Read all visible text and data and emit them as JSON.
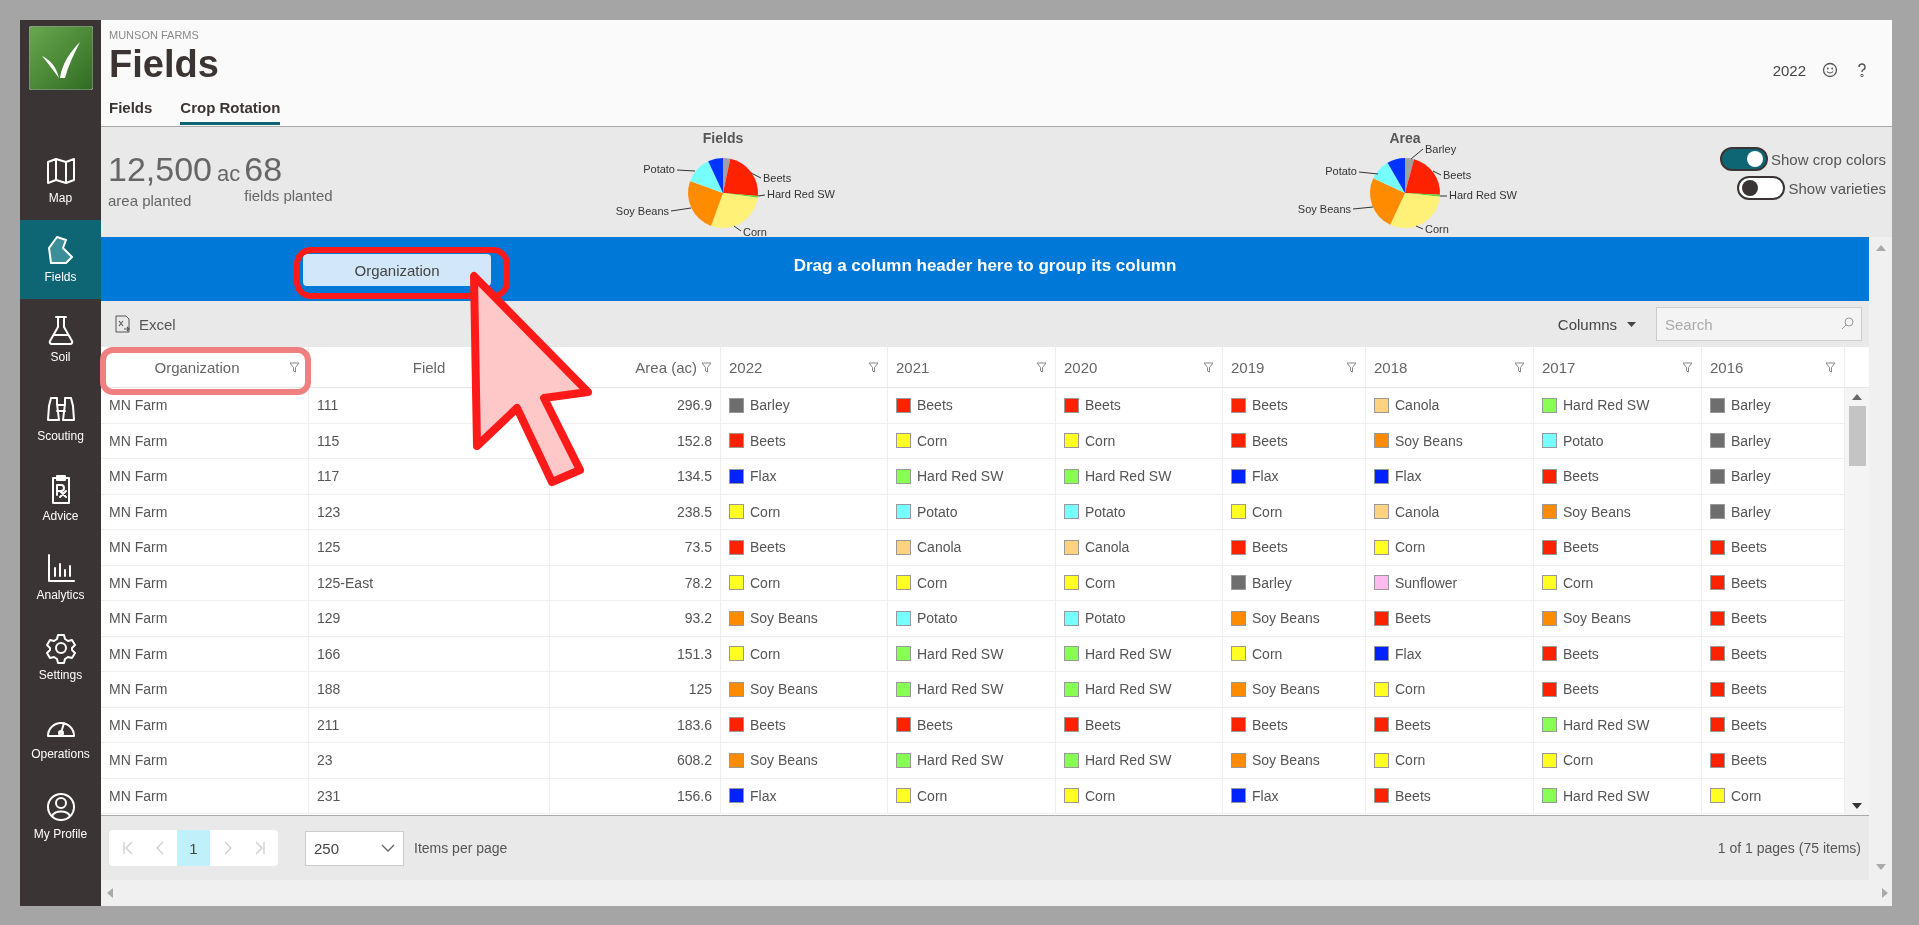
{
  "sidebar": {
    "items": [
      {
        "label": "Map",
        "selected": false
      },
      {
        "label": "Fields",
        "selected": true
      },
      {
        "label": "Soil",
        "selected": false
      },
      {
        "label": "Scouting",
        "selected": false
      },
      {
        "label": "Advice",
        "selected": false
      },
      {
        "label": "Analytics",
        "selected": false
      },
      {
        "label": "Settings",
        "selected": false
      },
      {
        "label": "Operations",
        "selected": false
      },
      {
        "label": "My Profile",
        "selected": false
      }
    ]
  },
  "header": {
    "organization": "MUNSON FARMS",
    "title": "Fields",
    "year": "2022"
  },
  "tabs": [
    {
      "label": "Fields",
      "selected": false
    },
    {
      "label": "Crop Rotation",
      "selected": true
    }
  ],
  "summary": {
    "area": "12,500",
    "area_unit": "ac",
    "area_label": "area planted",
    "fields": "68",
    "fields_label": "fields planted"
  },
  "pies": [
    {
      "title": "Fields",
      "labels": [
        "Potato",
        "Beets",
        "Hard Red SW",
        "Soy Beans",
        "Corn"
      ]
    },
    {
      "title": "Area",
      "labels": [
        "Barley",
        "Potato",
        "Beets",
        "Hard Red SW",
        "Soy Beans",
        "Corn"
      ]
    }
  ],
  "toggles": [
    {
      "label": "Show crop colors",
      "on": true
    },
    {
      "label": "Show varieties",
      "on": false
    }
  ],
  "group_panel": {
    "chips": [
      "Organization"
    ],
    "hint": "Drag a column header here to group its column"
  },
  "toolbar": {
    "export": "Excel",
    "columns": "Columns",
    "search": {
      "placeholder": "Search"
    }
  },
  "table": {
    "columns": [
      {
        "label": "Organization",
        "kind": "text",
        "filter": true
      },
      {
        "label": "Field",
        "kind": "text",
        "filter": false
      },
      {
        "label": "Area (ac)",
        "kind": "number",
        "filter": true
      },
      {
        "label": "2022",
        "kind": "crop",
        "filter": true
      },
      {
        "label": "2021",
        "kind": "crop",
        "filter": true
      },
      {
        "label": "2020",
        "kind": "crop",
        "filter": true
      },
      {
        "label": "2019",
        "kind": "crop",
        "filter": true
      },
      {
        "label": "2018",
        "kind": "crop",
        "filter": true
      },
      {
        "label": "2017",
        "kind": "crop",
        "filter": true
      },
      {
        "label": "2016",
        "kind": "crop",
        "filter": true
      }
    ],
    "rows": [
      {
        "organization": "MN Farm",
        "field": "111",
        "area": "296.9",
        "crops": [
          {
            "name": "Barley",
            "color": "#6e6e6e"
          },
          {
            "name": "Beets",
            "color": "#ff2200"
          },
          {
            "name": "Beets",
            "color": "#ff2200"
          },
          {
            "name": "Beets",
            "color": "#ff2200"
          },
          {
            "name": "Canola",
            "color": "#ffd27f"
          },
          {
            "name": "Hard Red SW",
            "color": "#88ff55"
          },
          {
            "name": "Barley",
            "color": "#6e6e6e"
          }
        ]
      },
      {
        "organization": "MN Farm",
        "field": "115",
        "area": "152.8",
        "crops": [
          {
            "name": "Beets",
            "color": "#ff2200"
          },
          {
            "name": "Corn",
            "color": "#ffff22"
          },
          {
            "name": "Corn",
            "color": "#ffff22"
          },
          {
            "name": "Beets",
            "color": "#ff2200"
          },
          {
            "name": "Soy Beans",
            "color": "#ff8c00"
          },
          {
            "name": "Potato",
            "color": "#77ffff"
          },
          {
            "name": "Barley",
            "color": "#6e6e6e"
          }
        ]
      },
      {
        "organization": "MN Farm",
        "field": "117",
        "area": "134.5",
        "crops": [
          {
            "name": "Flax",
            "color": "#0022ff"
          },
          {
            "name": "Hard Red SW",
            "color": "#88ff55"
          },
          {
            "name": "Hard Red SW",
            "color": "#88ff55"
          },
          {
            "name": "Flax",
            "color": "#0022ff"
          },
          {
            "name": "Flax",
            "color": "#0022ff"
          },
          {
            "name": "Beets",
            "color": "#ff2200"
          },
          {
            "name": "Barley",
            "color": "#6e6e6e"
          }
        ]
      },
      {
        "organization": "MN Farm",
        "field": "123",
        "area": "238.5",
        "crops": [
          {
            "name": "Corn",
            "color": "#ffff22"
          },
          {
            "name": "Potato",
            "color": "#77ffff"
          },
          {
            "name": "Potato",
            "color": "#77ffff"
          },
          {
            "name": "Corn",
            "color": "#ffff22"
          },
          {
            "name": "Canola",
            "color": "#ffd27f"
          },
          {
            "name": "Soy Beans",
            "color": "#ff8c00"
          },
          {
            "name": "Barley",
            "color": "#6e6e6e"
          }
        ]
      },
      {
        "organization": "MN Farm",
        "field": "125",
        "area": "73.5",
        "crops": [
          {
            "name": "Beets",
            "color": "#ff2200"
          },
          {
            "name": "Canola",
            "color": "#ffd27f"
          },
          {
            "name": "Canola",
            "color": "#ffd27f"
          },
          {
            "name": "Beets",
            "color": "#ff2200"
          },
          {
            "name": "Corn",
            "color": "#ffff22"
          },
          {
            "name": "Beets",
            "color": "#ff2200"
          },
          {
            "name": "Beets",
            "color": "#ff2200"
          }
        ]
      },
      {
        "organization": "MN Farm",
        "field": "125-East",
        "area": "78.2",
        "crops": [
          {
            "name": "Corn",
            "color": "#ffff22"
          },
          {
            "name": "Corn",
            "color": "#ffff22"
          },
          {
            "name": "Corn",
            "color": "#ffff22"
          },
          {
            "name": "Barley",
            "color": "#6e6e6e"
          },
          {
            "name": "Sunflower",
            "color": "#ffbbee"
          },
          {
            "name": "Corn",
            "color": "#ffff22"
          },
          {
            "name": "Beets",
            "color": "#ff2200"
          }
        ]
      },
      {
        "organization": "MN Farm",
        "field": "129",
        "area": "93.2",
        "crops": [
          {
            "name": "Soy Beans",
            "color": "#ff8c00"
          },
          {
            "name": "Potato",
            "color": "#77ffff"
          },
          {
            "name": "Potato",
            "color": "#77ffff"
          },
          {
            "name": "Soy Beans",
            "color": "#ff8c00"
          },
          {
            "name": "Beets",
            "color": "#ff2200"
          },
          {
            "name": "Soy Beans",
            "color": "#ff8c00"
          },
          {
            "name": "Beets",
            "color": "#ff2200"
          }
        ]
      },
      {
        "organization": "MN Farm",
        "field": "166",
        "area": "151.3",
        "crops": [
          {
            "name": "Corn",
            "color": "#ffff22"
          },
          {
            "name": "Hard Red SW",
            "color": "#88ff55"
          },
          {
            "name": "Hard Red SW",
            "color": "#88ff55"
          },
          {
            "name": "Corn",
            "color": "#ffff22"
          },
          {
            "name": "Flax",
            "color": "#0022ff"
          },
          {
            "name": "Beets",
            "color": "#ff2200"
          },
          {
            "name": "Beets",
            "color": "#ff2200"
          }
        ]
      },
      {
        "organization": "MN Farm",
        "field": "188",
        "area": "125",
        "crops": [
          {
            "name": "Soy Beans",
            "color": "#ff8c00"
          },
          {
            "name": "Hard Red SW",
            "color": "#88ff55"
          },
          {
            "name": "Hard Red SW",
            "color": "#88ff55"
          },
          {
            "name": "Soy Beans",
            "color": "#ff8c00"
          },
          {
            "name": "Corn",
            "color": "#ffff22"
          },
          {
            "name": "Beets",
            "color": "#ff2200"
          },
          {
            "name": "Beets",
            "color": "#ff2200"
          }
        ]
      },
      {
        "organization": "MN Farm",
        "field": "211",
        "area": "183.6",
        "crops": [
          {
            "name": "Beets",
            "color": "#ff2200"
          },
          {
            "name": "Beets",
            "color": "#ff2200"
          },
          {
            "name": "Beets",
            "color": "#ff2200"
          },
          {
            "name": "Beets",
            "color": "#ff2200"
          },
          {
            "name": "Beets",
            "color": "#ff2200"
          },
          {
            "name": "Hard Red SW",
            "color": "#88ff55"
          },
          {
            "name": "Beets",
            "color": "#ff2200"
          }
        ]
      },
      {
        "organization": "MN Farm",
        "field": "23",
        "area": "608.2",
        "crops": [
          {
            "name": "Soy Beans",
            "color": "#ff8c00"
          },
          {
            "name": "Hard Red SW",
            "color": "#88ff55"
          },
          {
            "name": "Hard Red SW",
            "color": "#88ff55"
          },
          {
            "name": "Soy Beans",
            "color": "#ff8c00"
          },
          {
            "name": "Corn",
            "color": "#ffff22"
          },
          {
            "name": "Corn",
            "color": "#ffff22"
          },
          {
            "name": "Beets",
            "color": "#ff2200"
          }
        ]
      },
      {
        "organization": "MN Farm",
        "field": "231",
        "area": "156.6",
        "crops": [
          {
            "name": "Flax",
            "color": "#0022ff"
          },
          {
            "name": "Corn",
            "color": "#ffff22"
          },
          {
            "name": "Corn",
            "color": "#ffff22"
          },
          {
            "name": "Flax",
            "color": "#0022ff"
          },
          {
            "name": "Beets",
            "color": "#ff2200"
          },
          {
            "name": "Hard Red SW",
            "color": "#88ff55"
          },
          {
            "name": "Corn",
            "color": "#ffff22"
          }
        ]
      }
    ]
  },
  "pager": {
    "pages": [
      {
        "label": "1",
        "selected": true
      }
    ],
    "page_size": "250",
    "page_size_label": "Items per page",
    "summary": "1 of 1 pages (75 items)"
  }
}
